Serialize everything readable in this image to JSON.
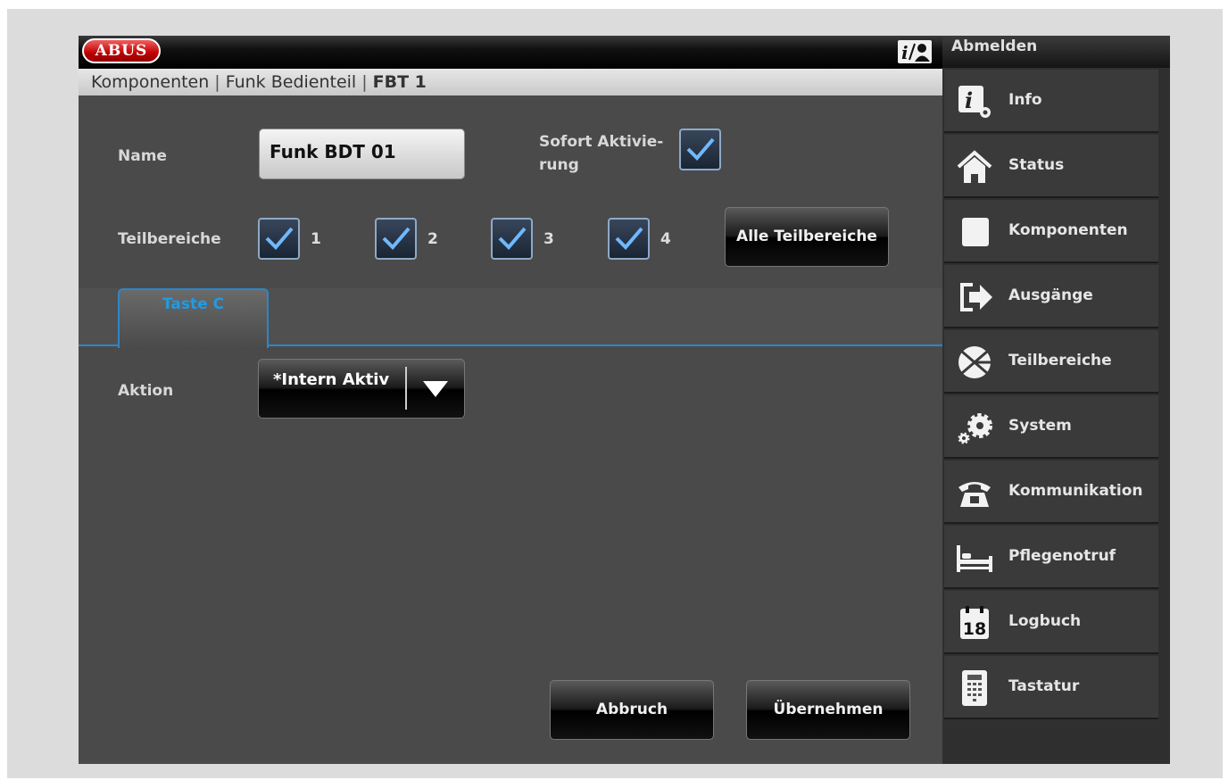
{
  "header": {
    "logo": "ABUS"
  },
  "breadcrumb": {
    "part1": "Komponenten",
    "sep1": "|",
    "part2": "Funk Bedienteil",
    "sep2": "|",
    "part3": "FBT 1"
  },
  "form": {
    "name_label": "Name",
    "name_value": "Funk BDT 01",
    "sofort_label_line1": "Sofort Aktivie-",
    "sofort_label_line2": "rung",
    "sofort_checked": true,
    "teilbereiche_label": "Teilbereiche",
    "teilbereiche": [
      {
        "num": "1",
        "checked": true
      },
      {
        "num": "2",
        "checked": true
      },
      {
        "num": "3",
        "checked": true
      },
      {
        "num": "4",
        "checked": true
      }
    ],
    "alle_button": "Alle Teilbereiche",
    "tab_label": "Taste C",
    "aktion_label": "Aktion",
    "aktion_value": "*Intern Aktiv"
  },
  "buttons": {
    "cancel": "Abbruch",
    "apply": "Übernehmen"
  },
  "sidebar": {
    "logout": "Abmelden",
    "items": [
      {
        "label": "Info",
        "icon": "info-gear-icon"
      },
      {
        "label": "Status",
        "icon": "home-icon"
      },
      {
        "label": "Komponenten",
        "icon": "square-icon"
      },
      {
        "label": "Ausgänge",
        "icon": "exit-arrow-icon"
      },
      {
        "label": "Teilbereiche",
        "icon": "pie-segments-icon"
      },
      {
        "label": "System",
        "icon": "gears-icon"
      },
      {
        "label": "Kommunikation",
        "icon": "telephone-icon"
      },
      {
        "label": "Pflegenotruf",
        "icon": "bed-icon"
      },
      {
        "label": "Logbuch",
        "icon": "calendar-icon",
        "badge": "18"
      },
      {
        "label": "Tastatur",
        "icon": "keypad-icon"
      }
    ]
  },
  "colors": {
    "accent": "#2d86c7",
    "tab_text": "#1f9be6",
    "background": "#4a4a4a",
    "sidebar": "#2f2f2f"
  }
}
